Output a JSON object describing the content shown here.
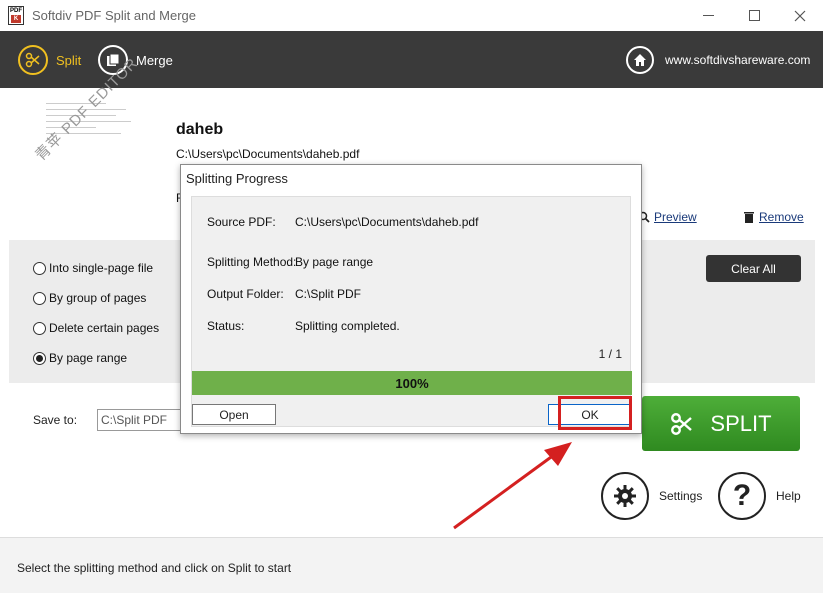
{
  "window": {
    "title": "Softdiv PDF Split and Merge",
    "icon_top": "PDF",
    "icon_bottom": "K"
  },
  "toolbar": {
    "split_label": "Split",
    "merge_label": "Merge",
    "website": "www.softdivshareware.com"
  },
  "file": {
    "name": "daheb",
    "path": "C:\\Users\\pc\\Documents\\daheb.pdf",
    "extra": "F",
    "preview_label": "Preview",
    "remove_label": "Remove",
    "watermark": "青苹 PDF EDITOR"
  },
  "options": {
    "items": [
      {
        "label": "Into single-page file",
        "selected": false
      },
      {
        "label": "By group of pages",
        "selected": false
      },
      {
        "label": "Delete certain pages",
        "selected": false
      },
      {
        "label": "By page range",
        "selected": true
      }
    ],
    "clear_all_label": "Clear All"
  },
  "save": {
    "label": "Save to:",
    "value": "C:\\Split PDF"
  },
  "actions": {
    "split_label": "SPLIT",
    "settings_label": "Settings",
    "help_label": "Help",
    "help_glyph": "?"
  },
  "status": {
    "text": "Select the splitting method and click on Split to start"
  },
  "dialog": {
    "title": "Splitting Progress",
    "rows": [
      {
        "label": "Source PDF:",
        "value": "C:\\Users\\pc\\Documents\\daheb.pdf"
      },
      {
        "label": "Splitting Method:",
        "value": "By page range"
      },
      {
        "label": "Output Folder:",
        "value": "C:\\Split PDF"
      },
      {
        "label": "Status:",
        "value": "Splitting completed."
      }
    ],
    "count": "1 / 1",
    "progress_text": "100%",
    "progress_value": 1.0,
    "open_label": "Open",
    "ok_label": "OK"
  },
  "colors": {
    "accent": "#f0c020",
    "toolbar_bg": "#3a3a3a",
    "split_green": "#3c9a2a",
    "progress_green": "#6fb04a",
    "highlight": "#d42020"
  }
}
